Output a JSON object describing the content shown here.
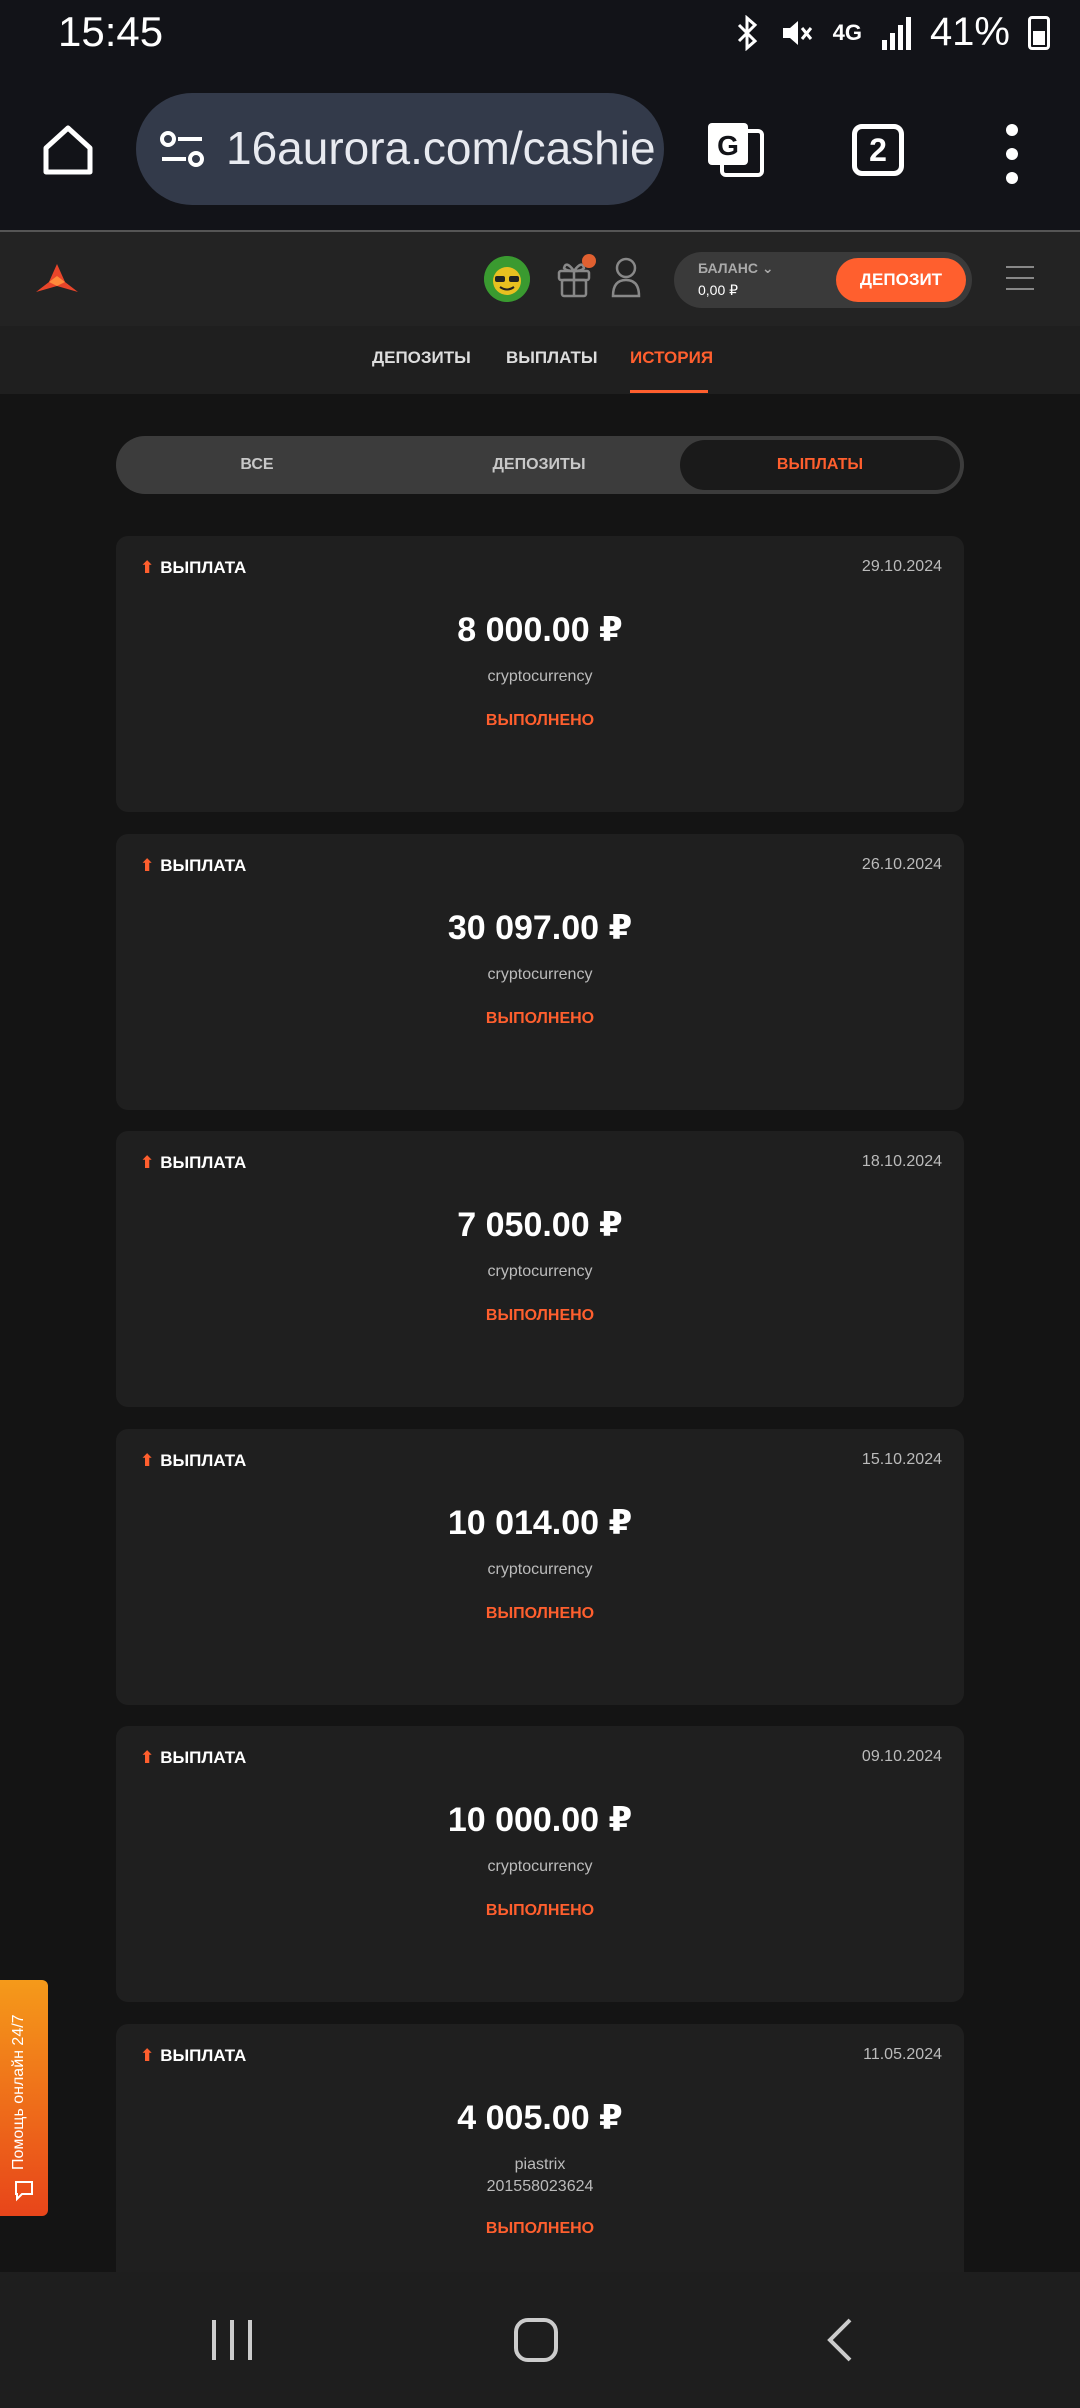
{
  "status_bar": {
    "time": "15:45",
    "network": "4G",
    "battery": "41%"
  },
  "browser": {
    "url": "16aurora.com/cashie",
    "tab_count": "2"
  },
  "header": {
    "balance_label": "БАЛАНС",
    "balance_value": "0,00 ₽",
    "deposit_button": "ДЕПОЗИТ"
  },
  "subnav": {
    "tabs": [
      "ДЕПОЗИТЫ",
      "ВЫПЛАТЫ",
      "ИСТОРИЯ"
    ],
    "active": "ИСТОРИЯ"
  },
  "filter": {
    "options": [
      "ВСЕ",
      "ДЕПОЗИТЫ",
      "ВЫПЛАТЫ"
    ],
    "active": "ВЫПЛАТЫ"
  },
  "transactions": [
    {
      "type": "ВЫПЛАТА",
      "date": "29.10.2024",
      "amount": "8 000.00 ₽",
      "method": "cryptocurrency",
      "account": "",
      "status": "ВЫПОЛНЕНО"
    },
    {
      "type": "ВЫПЛАТА",
      "date": "26.10.2024",
      "amount": "30 097.00 ₽",
      "method": "cryptocurrency",
      "account": "",
      "status": "ВЫПОЛНЕНО"
    },
    {
      "type": "ВЫПЛАТА",
      "date": "18.10.2024",
      "amount": "7 050.00 ₽",
      "method": "cryptocurrency",
      "account": "",
      "status": "ВЫПОЛНЕНО"
    },
    {
      "type": "ВЫПЛАТА",
      "date": "15.10.2024",
      "amount": "10 014.00 ₽",
      "method": "cryptocurrency",
      "account": "",
      "status": "ВЫПОЛНЕНО"
    },
    {
      "type": "ВЫПЛАТА",
      "date": "09.10.2024",
      "amount": "10 000.00 ₽",
      "method": "cryptocurrency",
      "account": "",
      "status": "ВЫПОЛНЕНО"
    },
    {
      "type": "ВЫПЛАТА",
      "date": "11.05.2024",
      "amount": "4 005.00 ₽",
      "method": "piastrix",
      "account": "201558023624",
      "status": "ВЫПОЛНЕНО"
    }
  ],
  "help_tab": "Помощь онлайн 24/7",
  "colors": {
    "accent": "#ff5f2e",
    "background": "#141414",
    "card": "#1f1f1f"
  }
}
